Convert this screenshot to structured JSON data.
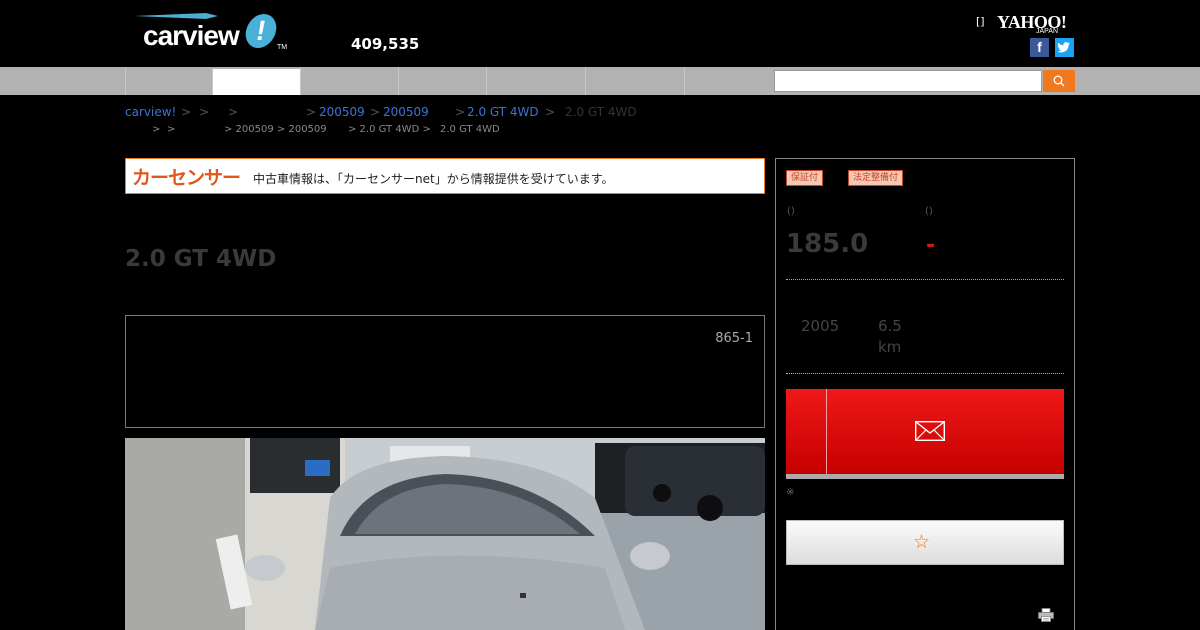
{
  "header": {
    "logo_text": "carview",
    "logo_mark": "!",
    "logo_tm": "TM",
    "member_count": "409,535",
    "bracket_link": "[]",
    "yahoo_text": "YAHOO!",
    "yahoo_sub": "JAPAN",
    "facebook_glyph": "f",
    "twitter_glyph": "t"
  },
  "search": {
    "placeholder": "",
    "value": ""
  },
  "breadcrumb": {
    "home": "carview!",
    "level_200509_a": "200509",
    "level_200509_b": "200509",
    "grade_link": "2.0 GT 4WD",
    "current": "2.0 GT 4WD",
    "sep": ">"
  },
  "breadcrumb2": {
    "sep": ">",
    "seg_a": "> 200509 > 200509",
    "seg_b": "> 2.0 GT 4WD >",
    "seg_c": "2.0 GT 4WD"
  },
  "carsensor": {
    "logo": "カーセンサー",
    "text": "中古車情報は、「カーセンサーnet」から情報提供を受けています。"
  },
  "car_title": "2.0 GT 4WD",
  "shop_code": "865-1",
  "side": {
    "badge_warranty": "保証付",
    "badge_inspection": "法定整備付",
    "label_a": "()",
    "label_b": "()",
    "price": "185.0",
    "total_price": "-",
    "year": "2005",
    "mileage": "6.5",
    "mileage_unit": "km",
    "note": "※",
    "colors": {
      "contact": "#e01010",
      "search_button": "#f0781e"
    }
  },
  "icons": {
    "search": "search-icon",
    "mail": "mail-icon",
    "star": "star-icon",
    "printer": "printer-icon"
  }
}
